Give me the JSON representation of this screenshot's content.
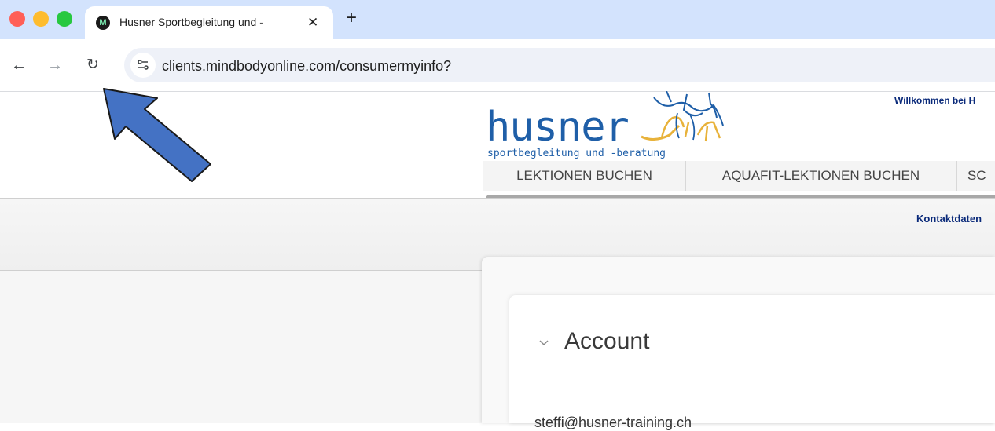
{
  "browser": {
    "tab": {
      "title": "Husner Sportbegleitung und -",
      "favicon": "mindbody-icon",
      "close_label": "✕"
    },
    "new_tab_label": "+",
    "nav": {
      "back": "←",
      "forward": "→",
      "reload": "↻"
    },
    "site_info_icon": "tune-icon",
    "url": "clients.mindbodyonline.com/consumermyinfo?"
  },
  "annotation": {
    "arrow_color": "#4472c4",
    "arrow_direction": "up-left"
  },
  "header": {
    "logo": {
      "wordmark": "husner",
      "tagline": "sportbegleitung und -beratung",
      "brand_color": "#1f5fa8",
      "accent_color": "#e8b23a"
    },
    "welcome": "Willkommen bei H",
    "menu": [
      "LEKTIONEN BUCHEN",
      "AQUAFIT-LEKTIONEN BUCHEN",
      "SC"
    ]
  },
  "subnav": {
    "contact": "Kontaktdaten"
  },
  "account": {
    "title": "Account",
    "email": "steffi@husner-training.ch"
  }
}
